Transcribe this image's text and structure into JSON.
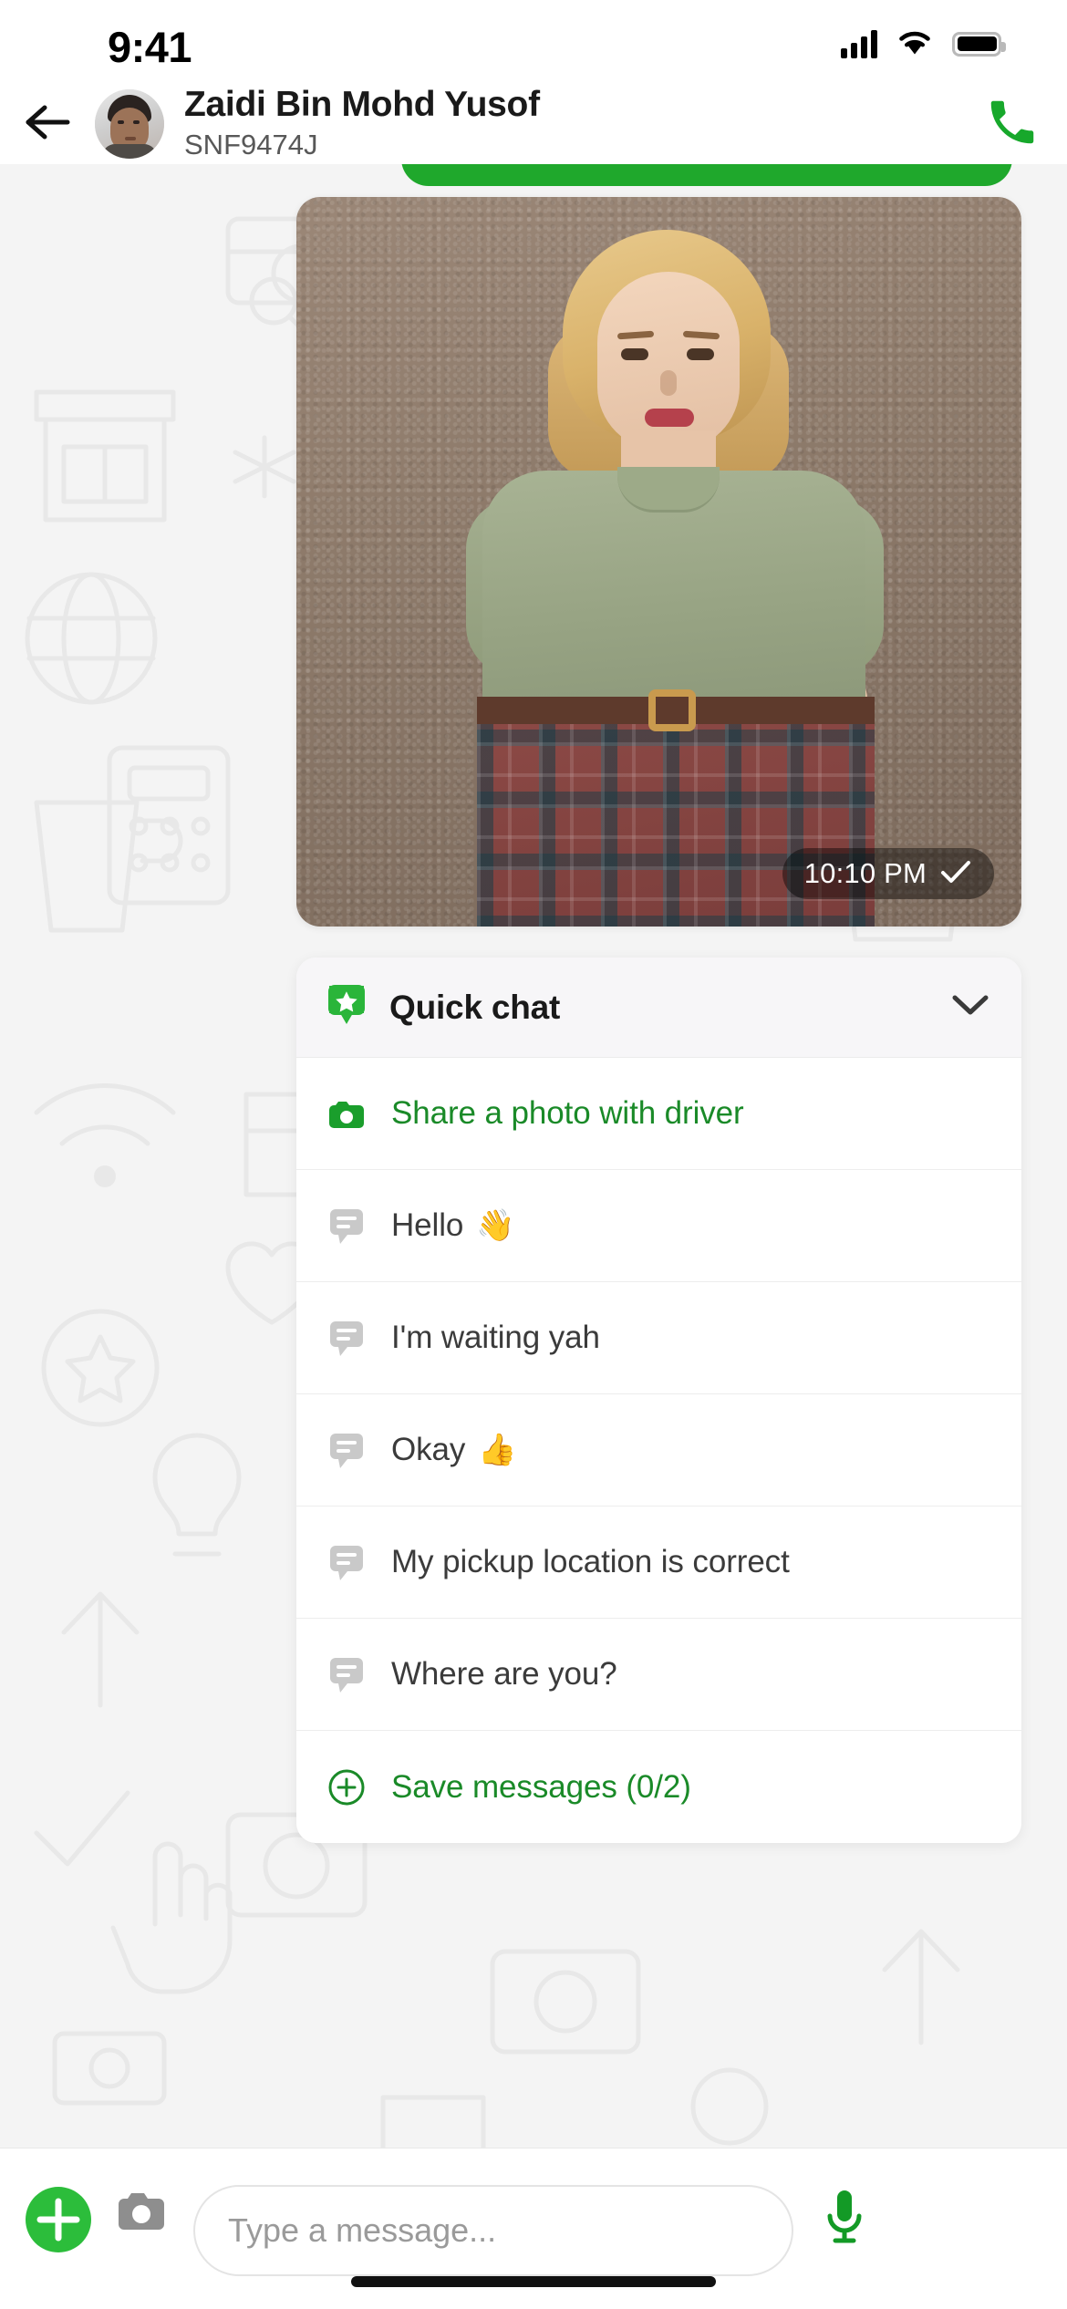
{
  "status_bar": {
    "time": "9:41",
    "cellular_icon": "signal-bars-icon",
    "wifi_icon": "wifi-icon",
    "battery_icon": "battery-full-icon"
  },
  "header": {
    "back_icon": "back-arrow-icon",
    "avatar_icon": "contact-avatar",
    "contact_name": "Zaidi Bin Mohd Yusof",
    "contact_subtitle": "SNF9474J",
    "call_icon": "phone-call-icon"
  },
  "chat": {
    "image_message": {
      "timestamp": "10:10 PM",
      "status_icon": "single-check-icon"
    }
  },
  "quick_chat": {
    "title": "Quick chat",
    "header_icon": "quick-chat-star-bubble-icon",
    "collapse_icon": "chevron-down-icon",
    "items": [
      {
        "label": "Share a photo with driver",
        "icon": "camera-icon",
        "style": "green",
        "emoji": ""
      },
      {
        "label": "Hello",
        "icon": "message-bubble-icon",
        "style": "default",
        "emoji": "👋"
      },
      {
        "label": "I'm waiting yah",
        "icon": "message-bubble-icon",
        "style": "default",
        "emoji": ""
      },
      {
        "label": "Okay",
        "icon": "message-bubble-icon",
        "style": "default",
        "emoji": "👍"
      },
      {
        "label": "My pickup location is correct",
        "icon": "message-bubble-icon",
        "style": "default",
        "emoji": ""
      },
      {
        "label": "Where are you?",
        "icon": "message-bubble-icon",
        "style": "default",
        "emoji": ""
      }
    ],
    "save_row": {
      "label": "Save messages (0/2)",
      "icon": "plus-circle-icon",
      "style": "green"
    }
  },
  "composer": {
    "attach_icon": "plus-circle-filled-icon",
    "camera_icon": "camera-icon",
    "input_value": "",
    "input_placeholder": "Type a message...",
    "mic_icon": "microphone-icon"
  },
  "colors": {
    "brand_green": "#1FA82C",
    "link_green": "#1a8a28",
    "chat_background": "#f4f4f4",
    "panel_background": "#ffffff",
    "panel_header_background": "#f7f6f8"
  }
}
